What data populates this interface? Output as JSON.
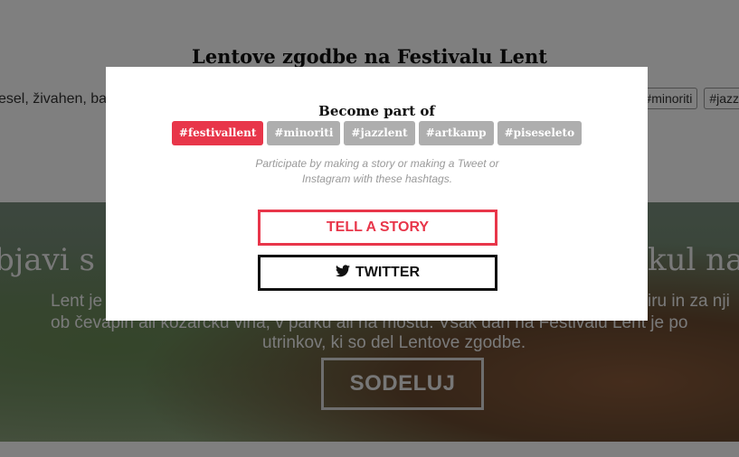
{
  "background": {
    "title": "Lentove zgodbe na Festivalu Lent",
    "subtitle_fragment": "esel, živahen, bar",
    "right_tags": [
      "#minoriti",
      "#jazz"
    ],
    "hero": {
      "headline_left": "bjavi s",
      "headline_right": "kul na",
      "text_line1_left": "Lent je",
      "text_line1_right": "iru in za nji",
      "text_line2_left": "ob čevapih ali kozarcku vina, v parku ali na mostu. Vsak dan na Festivalu Lent je po",
      "text_line3": "utrinkov, ki so del Lentove zgodbe.",
      "button_label": "SODELUJ"
    }
  },
  "modal": {
    "heading": "Become part of",
    "hashtags": [
      {
        "label": "#festivallent",
        "active": true
      },
      {
        "label": "#minoriti",
        "active": false
      },
      {
        "label": "#jazzlent",
        "active": false
      },
      {
        "label": "#artkamp",
        "active": false
      },
      {
        "label": "#piseseleto",
        "active": false
      }
    ],
    "note": "Participate by making a story or making a Tweet or Instagram with these hashtags.",
    "tell_story_label": "TELL A STORY",
    "twitter_label": "TWITTER",
    "twitter_icon": "twitter-bird-icon"
  },
  "colors": {
    "accent": "#e8364a",
    "tag_inactive": "#aeaeae",
    "overlay": "rgba(0,0,0,0.5)"
  }
}
